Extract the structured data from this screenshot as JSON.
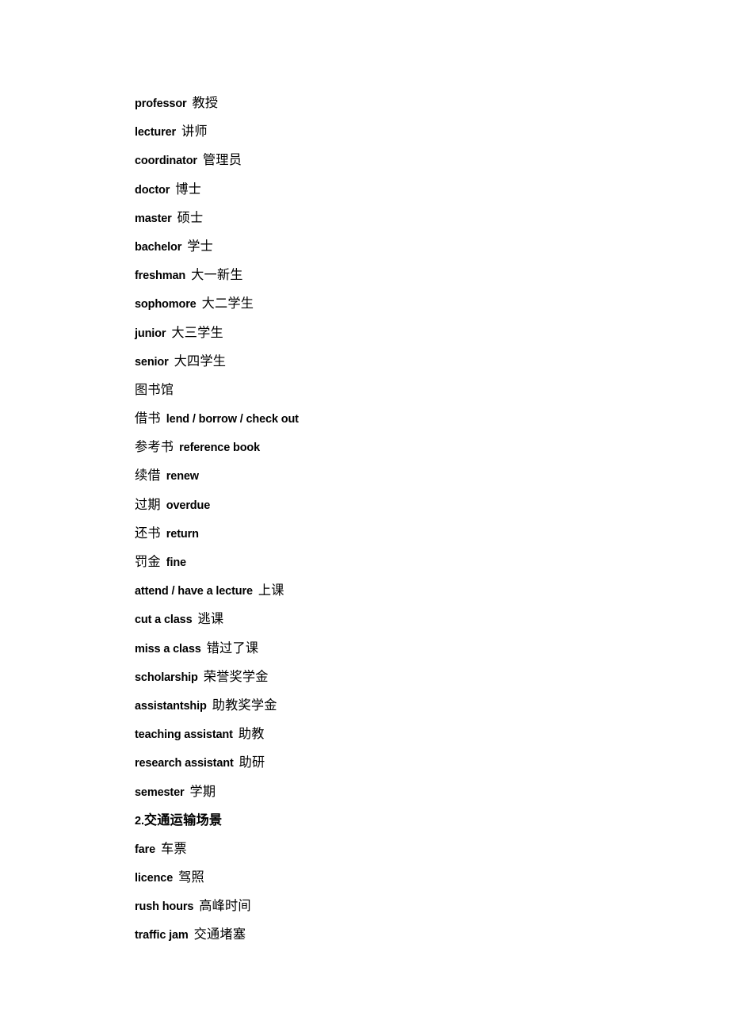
{
  "document": {
    "background_color": "#ffffff",
    "text_color": "#000000",
    "lines": [
      {
        "en": "professor",
        "cn": "教授"
      },
      {
        "en": "lecturer",
        "cn": "讲师"
      },
      {
        "en": "coordinator",
        "cn": "管理员"
      },
      {
        "en": "doctor",
        "cn": "博士"
      },
      {
        "en": "master",
        "cn": "硕士"
      },
      {
        "en": "bachelor",
        "cn": "学士"
      },
      {
        "en": "freshman",
        "cn": "大一新生"
      },
      {
        "en": "sophomore",
        "cn": "大二学生"
      },
      {
        "en": "junior",
        "cn": "大三学生"
      },
      {
        "en": "senior",
        "cn": "大四学生"
      },
      {
        "en": "",
        "cn": "图书馆"
      },
      {
        "cn": "借书",
        "en": "lend / borrow / check out",
        "cn_first": true
      },
      {
        "cn": "参考书",
        "en": "reference book",
        "cn_first": true
      },
      {
        "cn": "续借",
        "en": "renew",
        "cn_first": true
      },
      {
        "cn": "过期",
        "en": "overdue",
        "cn_first": true
      },
      {
        "cn": "还书",
        "en": "return",
        "cn_first": true
      },
      {
        "cn": "罚金",
        "en": "fine",
        "cn_first": true
      },
      {
        "en": "attend / have a lecture",
        "cn": "上课"
      },
      {
        "en": "cut a class",
        "cn": "逃课"
      },
      {
        "en": "miss a class",
        "cn": "错过了课"
      },
      {
        "en": "scholarship",
        "cn": "荣誉奖学金"
      },
      {
        "en": "assistantship",
        "cn": "助教奖学金"
      },
      {
        "en": "teaching assistant",
        "cn": "助教"
      },
      {
        "en": "research assistant",
        "cn": "助研"
      },
      {
        "en": "semester",
        "cn": "学期"
      },
      {
        "heading": true,
        "num": "2.",
        "cn": "交通运输场景"
      },
      {
        "en": "fare",
        "cn": "车票"
      },
      {
        "en": "licence",
        "cn": "驾照"
      },
      {
        "en": "rush hours",
        "cn": "高峰时间"
      },
      {
        "en": "traffic jam",
        "cn": "交通堵塞"
      }
    ]
  }
}
